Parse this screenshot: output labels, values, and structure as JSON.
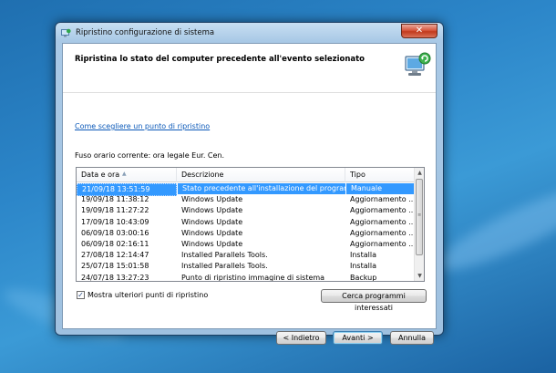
{
  "window": {
    "title": "Ripristino configurazione di sistema",
    "close_label": "✕"
  },
  "header": {
    "title": "Ripristina lo stato del computer precedente all'evento selezionato"
  },
  "help_link": "Come scegliere un punto di ripristino",
  "timezone": "Fuso orario corrente: ora legale Eur. Cen.",
  "table": {
    "columns": [
      "Data e ora",
      "Descrizione",
      "Tipo"
    ],
    "rows": [
      {
        "date": "21/09/18 13:51:59",
        "desc": "Stato precedente all'installazione del programm...",
        "type": "Manuale",
        "selected": true
      },
      {
        "date": "19/09/18 11:38:12",
        "desc": "Windows Update",
        "type": "Aggiornamento ...",
        "selected": false
      },
      {
        "date": "19/09/18 11:27:22",
        "desc": "Windows Update",
        "type": "Aggiornamento ...",
        "selected": false
      },
      {
        "date": "17/09/18 10:43:09",
        "desc": "Windows Update",
        "type": "Aggiornamento ...",
        "selected": false
      },
      {
        "date": "06/09/18 03:00:16",
        "desc": "Windows Update",
        "type": "Aggiornamento ...",
        "selected": false
      },
      {
        "date": "06/09/18 02:16:11",
        "desc": "Windows Update",
        "type": "Aggiornamento ...",
        "selected": false
      },
      {
        "date": "27/08/18 12:14:47",
        "desc": "Installed Parallels Tools.",
        "type": "Installa",
        "selected": false
      },
      {
        "date": "25/07/18 15:01:58",
        "desc": "Installed Parallels Tools.",
        "type": "Installa",
        "selected": false
      },
      {
        "date": "24/07/18 13:27:23",
        "desc": "Punto di ripristino immagine di sistema",
        "type": "Backup",
        "selected": false
      }
    ]
  },
  "checkbox": {
    "label": "Mostra ulteriori punti di ripristino",
    "checked": true,
    "mark": "✓"
  },
  "buttons": {
    "search": "Cerca programmi interessati",
    "back": "< Indietro",
    "next": "Avanti >",
    "cancel": "Annulla"
  },
  "scrollbar": {
    "up": "▲",
    "down": "▼",
    "grip": "≡"
  },
  "colors": {
    "selection": "#3399ff",
    "link": "#0a58b8",
    "close_red": "#c23a1d"
  }
}
